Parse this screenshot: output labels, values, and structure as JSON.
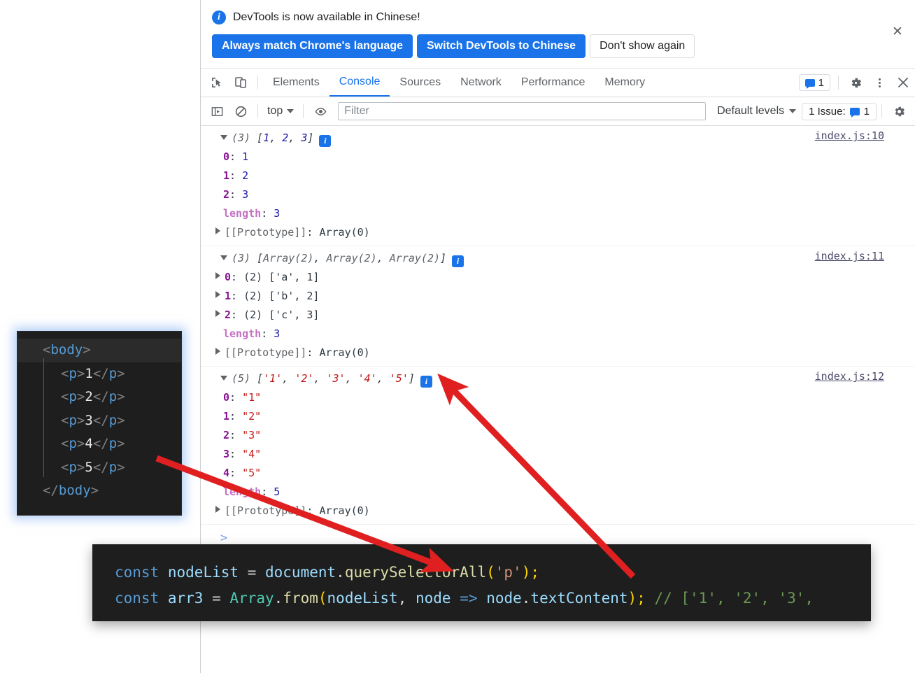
{
  "banner": {
    "icon": "info-icon",
    "message": "DevTools is now available in Chinese!",
    "buttons": [
      {
        "label": "Always match Chrome's language",
        "style": "primary"
      },
      {
        "label": "Switch DevTools to Chinese",
        "style": "primary"
      },
      {
        "label": "Don't show again",
        "style": "plain"
      }
    ],
    "close_label": "✕"
  },
  "tabbar": {
    "inspect_icon": "inspect-element-icon",
    "device_icon": "device-toolbar-icon",
    "tabs": [
      {
        "label": "Elements",
        "active": false
      },
      {
        "label": "Console",
        "active": true
      },
      {
        "label": "Sources",
        "active": false
      },
      {
        "label": "Network",
        "active": false
      },
      {
        "label": "Performance",
        "active": false
      },
      {
        "label": "Memory",
        "active": false
      }
    ],
    "issues_count": "1",
    "settings_icon": "gear-icon",
    "more_icon": "more-vertical-icon",
    "close_icon": "close-icon"
  },
  "filterbar": {
    "sidebar_icon": "console-sidebar-icon",
    "clear_icon": "clear-console-icon",
    "context": "top",
    "eye_icon": "live-expression-icon",
    "filter_placeholder": "Filter",
    "filter_value": "",
    "levels": "Default levels",
    "issues_label": "1 Issue:",
    "issues_count": "1",
    "settings_icon": "gear-icon"
  },
  "console": {
    "groups": [
      {
        "source": "index.js:10",
        "header": {
          "count": "(3)",
          "preview": "[1, 2, 3]",
          "parts": [
            {
              "t": "[",
              "c": "punct"
            },
            {
              "t": "1",
              "c": "num"
            },
            {
              "t": ", ",
              "c": "punct"
            },
            {
              "t": "2",
              "c": "num"
            },
            {
              "t": ", ",
              "c": "punct"
            },
            {
              "t": "3",
              "c": "num"
            },
            {
              "t": "]",
              "c": "punct"
            }
          ]
        },
        "rows": [
          {
            "key": "0",
            "keytype": "idx",
            "val": "1",
            "valtype": "num",
            "expandable": false
          },
          {
            "key": "1",
            "keytype": "idx",
            "val": "2",
            "valtype": "num",
            "expandable": false
          },
          {
            "key": "2",
            "keytype": "idx",
            "val": "3",
            "valtype": "num",
            "expandable": false
          },
          {
            "key": "length",
            "keytype": "len",
            "val": "3",
            "valtype": "num",
            "expandable": false
          },
          {
            "key": "[[Prototype]]",
            "keytype": "proto",
            "val": "Array(0)",
            "valtype": "plain",
            "expandable": true
          }
        ]
      },
      {
        "source": "index.js:11",
        "header": {
          "count": "(3)",
          "preview": "[Array(2), Array(2), Array(2)]",
          "parts": [
            {
              "t": "[",
              "c": "punct"
            },
            {
              "t": "Array(2)",
              "c": "obj"
            },
            {
              "t": ", ",
              "c": "punct"
            },
            {
              "t": "Array(2)",
              "c": "obj"
            },
            {
              "t": ", ",
              "c": "punct"
            },
            {
              "t": "Array(2)",
              "c": "obj"
            },
            {
              "t": "]",
              "c": "punct"
            }
          ]
        },
        "rows": [
          {
            "key": "0",
            "keytype": "idx",
            "val": "(2) ['a', 1]",
            "valtype": "arr",
            "expandable": true
          },
          {
            "key": "1",
            "keytype": "idx",
            "val": "(2) ['b', 2]",
            "valtype": "arr",
            "expandable": true
          },
          {
            "key": "2",
            "keytype": "idx",
            "val": "(2) ['c', 3]",
            "valtype": "arr",
            "expandable": true
          },
          {
            "key": "length",
            "keytype": "len",
            "val": "3",
            "valtype": "num",
            "expandable": false
          },
          {
            "key": "[[Prototype]]",
            "keytype": "proto",
            "val": "Array(0)",
            "valtype": "plain",
            "expandable": true
          }
        ]
      },
      {
        "source": "index.js:12",
        "header": {
          "count": "(5)",
          "preview": "['1', '2', '3', '4', '5']",
          "parts": [
            {
              "t": "[",
              "c": "punct"
            },
            {
              "t": "'1'",
              "c": "str"
            },
            {
              "t": ", ",
              "c": "punct"
            },
            {
              "t": "'2'",
              "c": "str"
            },
            {
              "t": ", ",
              "c": "punct"
            },
            {
              "t": "'3'",
              "c": "str"
            },
            {
              "t": ", ",
              "c": "punct"
            },
            {
              "t": "'4'",
              "c": "str"
            },
            {
              "t": ", ",
              "c": "punct"
            },
            {
              "t": "'5'",
              "c": "str"
            },
            {
              "t": "]",
              "c": "punct"
            }
          ]
        },
        "rows": [
          {
            "key": "0",
            "keytype": "idx",
            "val": "\"1\"",
            "valtype": "str",
            "expandable": false
          },
          {
            "key": "1",
            "keytype": "idx",
            "val": "\"2\"",
            "valtype": "str",
            "expandable": false
          },
          {
            "key": "2",
            "keytype": "idx",
            "val": "\"3\"",
            "valtype": "str",
            "expandable": false
          },
          {
            "key": "3",
            "keytype": "idx",
            "val": "\"4\"",
            "valtype": "str",
            "expandable": false
          },
          {
            "key": "4",
            "keytype": "idx",
            "val": "\"5\"",
            "valtype": "str",
            "expandable": false
          },
          {
            "key": "length",
            "keytype": "len",
            "val": "5",
            "valtype": "num",
            "expandable": false
          },
          {
            "key": "[[Prototype]]",
            "keytype": "proto",
            "val": "Array(0)",
            "valtype": "plain",
            "expandable": true
          }
        ]
      }
    ],
    "prompt": ">"
  },
  "html_card": {
    "lines": [
      "<body>",
      "  <p>1</p>",
      "  <p>2</p>",
      "  <p>3</p>",
      "  <p>4</p>",
      "  <p>5</p>",
      "</body>"
    ]
  },
  "js_card": {
    "line1": "const nodeList = document.querySelectorAll('p');",
    "line2": "const arr3 = Array.from(nodeList, node => node.textContent); // ['1', '2', '3',"
  },
  "annotations": {
    "arrow_color": "#e02020",
    "arrow1_name": "arrow-nodelist-to-html",
    "arrow2_name": "arrow-arr3-to-console"
  }
}
